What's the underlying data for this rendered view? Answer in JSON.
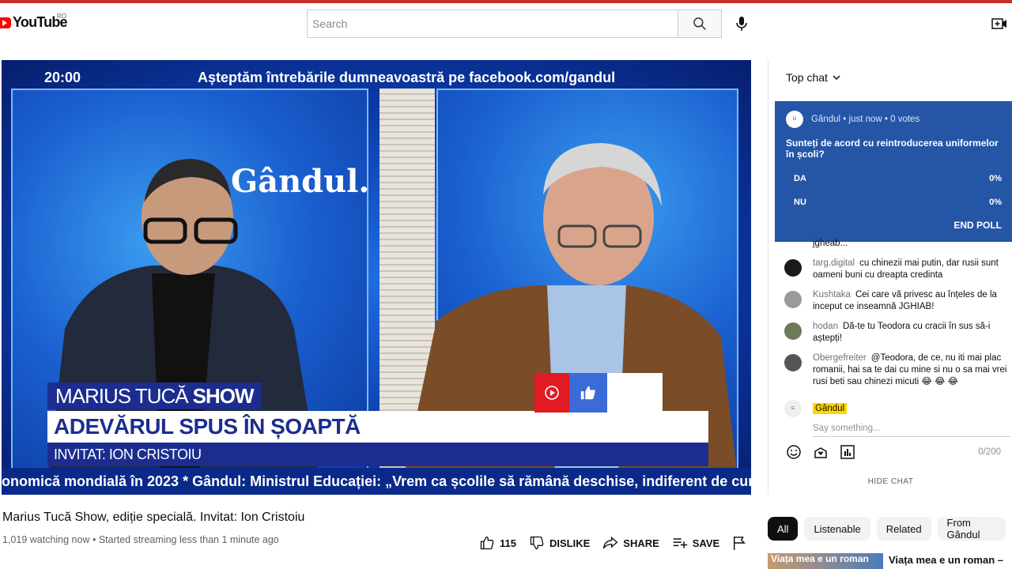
{
  "header": {
    "logo_text": "YouTube",
    "country": "RO",
    "search_placeholder": "Search"
  },
  "video": {
    "time": "20:00",
    "question_banner": "Așteptăm întrebările  dumneavoastră pe facebook.com/gandul",
    "brand": "Gândul.",
    "show_name": "MARIUS TUCĂ",
    "show_suffix": "SHOW",
    "episode_title": "ADEVĂRUL SPUS ÎN ȘOAPTĂ",
    "guest": "INVITAT: ION CRISTOIU",
    "crawl": "onomică mondială în 2023 * Gândul: Ministrul Educației: „Vrem ca școlile să rămână deschise, indiferent de cursul p"
  },
  "info": {
    "title": "Marius Tucă Show, ediție specială. Invitat: Ion Cristoiu",
    "meta": "1,019 watching now • Started streaming less than 1 minute ago",
    "like_count": "115",
    "dislike_label": "DISLIKE",
    "share_label": "SHARE",
    "save_label": "SAVE"
  },
  "chat": {
    "mode": "Top chat",
    "poll": {
      "author": "Gândul",
      "meta": "• just now • 0 votes",
      "question": "Sunteți de acord cu reintroducerea uniformelor în școli?",
      "options": [
        {
          "label": "DA",
          "value": "0%"
        },
        {
          "label": "NU",
          "value": "0%"
        }
      ],
      "end_label": "END POLL"
    },
    "partial_message": "jgheab...",
    "messages": [
      {
        "author": "targ.digital",
        "text": "cu chinezii mai putin, dar rusii sunt oameni buni cu dreapta credinta"
      },
      {
        "author": "Kushtaka",
        "text": "Cei care vă privesc au înțeles de la inceput ce inseamnă JGHIAB!"
      },
      {
        "author": "hodan",
        "text": "Dă-te tu Teodora cu cracii în sus să-i aștepți!"
      },
      {
        "author": "Obergefreiter",
        "text": "@Teodora, de ce, nu iti mai plac romanii, hai sa te dai cu mine si nu o sa mai vrei rusi beti sau chinezi micuti 😂 😂 😂"
      }
    ],
    "composer_name": "Gândul",
    "composer_placeholder": "Say something...",
    "char_count": "0/200",
    "hide_label": "HIDE CHAT"
  },
  "chips": [
    "All",
    "Listenable",
    "Related",
    "From Gândul"
  ],
  "recommendation": {
    "thumb_text": "Viața mea e un roman",
    "title": "Viața mea e un roman –"
  }
}
